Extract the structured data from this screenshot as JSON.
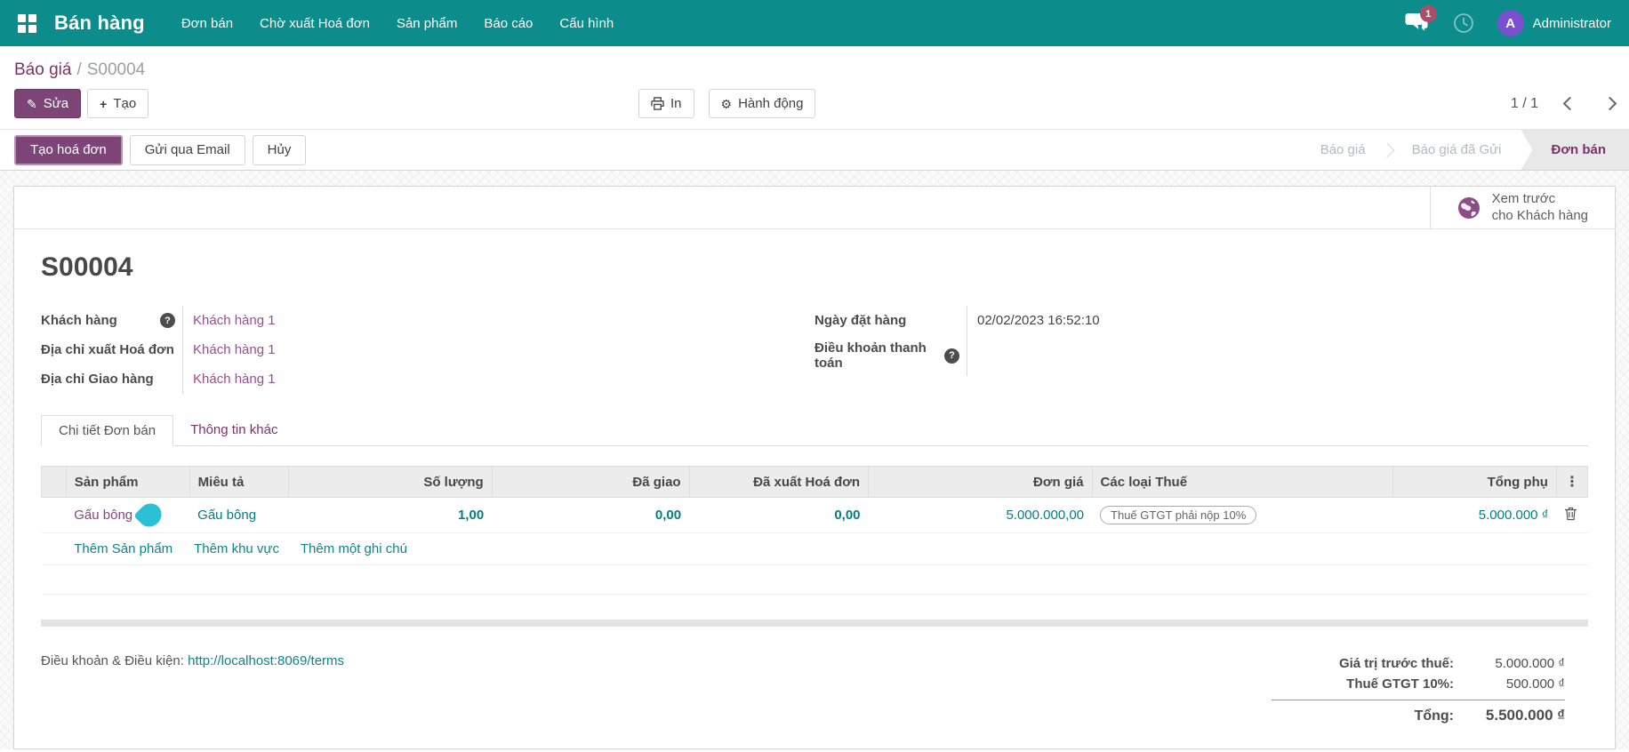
{
  "navbar": {
    "brand": "Bán hàng",
    "items": [
      "Đơn bán",
      "Chờ xuất Hoá đơn",
      "Sản phẩm",
      "Báo cáo",
      "Cấu hình"
    ],
    "badge_count": "1",
    "user_initial": "A",
    "user_name": "Administrator"
  },
  "breadcrumb": {
    "parent": "Báo giá",
    "separator": "/",
    "current": "S00004"
  },
  "actions": {
    "edit": "Sửa",
    "create": "Tạo",
    "print": "In",
    "action": "Hành động"
  },
  "pager": {
    "value": "1 / 1"
  },
  "statusbar": {
    "buttons": [
      {
        "label": "Tạo hoá đơn",
        "primary": true
      },
      {
        "label": "Gửi qua Email",
        "primary": false
      },
      {
        "label": "Hủy",
        "primary": false
      }
    ],
    "states": [
      {
        "label": "Báo giá",
        "active": false
      },
      {
        "label": "Báo giá đã Gửi",
        "active": false
      },
      {
        "label": "Đơn bán",
        "active": true
      }
    ]
  },
  "sheet": {
    "preview_link": {
      "line1": "Xem trước",
      "line2": "cho Khách hàng"
    },
    "title": "S00004",
    "fields_left": [
      {
        "label": "Khách hàng",
        "value": "Khách hàng 1"
      },
      {
        "label": "Địa chỉ xuất Hoá đơn",
        "value": "Khách hàng 1"
      },
      {
        "label": "Địa chỉ Giao hàng",
        "value": "Khách hàng 1"
      }
    ],
    "fields_right": [
      {
        "label": "Ngày đặt hàng",
        "value": "02/02/2023 16:52:10"
      },
      {
        "label": "Điều khoản thanh toán",
        "value": ""
      }
    ],
    "tabs": [
      {
        "label": "Chi tiết Đơn bán",
        "active": true
      },
      {
        "label": "Thông tin khác",
        "active": false
      }
    ],
    "table": {
      "headers": [
        "Sản phẩm",
        "Miêu tả",
        "Số lượng",
        "Đã giao",
        "Đã xuất Hoá đơn",
        "Đơn giá",
        "Các loại Thuế",
        "Tổng phụ"
      ],
      "rows": [
        {
          "product": "Gấu bông",
          "description": "Gấu bông",
          "qty": "1,00",
          "delivered": "0,00",
          "invoiced": "0,00",
          "unit_price": "5.000.000,00",
          "tax": "Thuế GTGT phải nộp 10%",
          "subtotal": "5.000.000 ₫"
        }
      ],
      "footer_links": [
        "Thêm Sản phẩm",
        "Thêm khu vực",
        "Thêm một ghi chú"
      ]
    },
    "terms": {
      "label": "Điều khoản & Điều kiện:",
      "link": "http://localhost:8069/terms"
    },
    "totals": {
      "rows": [
        {
          "label": "Giá trị trước thuế:",
          "value": "5.000.000 ₫"
        },
        {
          "label": "Thuế GTGT 10%:",
          "value": "500.000 ₫"
        }
      ],
      "total": {
        "label": "Tổng:",
        "value": "5.500.000 ₫"
      }
    }
  },
  "colors": {
    "navbar": "#0c8c8a",
    "primary": "#7d4577",
    "link": "#9a4d92",
    "teal": "#017e84",
    "badge": "#ad4e66",
    "avatar": "#7a4fd0",
    "state-active": "#7a3369"
  }
}
